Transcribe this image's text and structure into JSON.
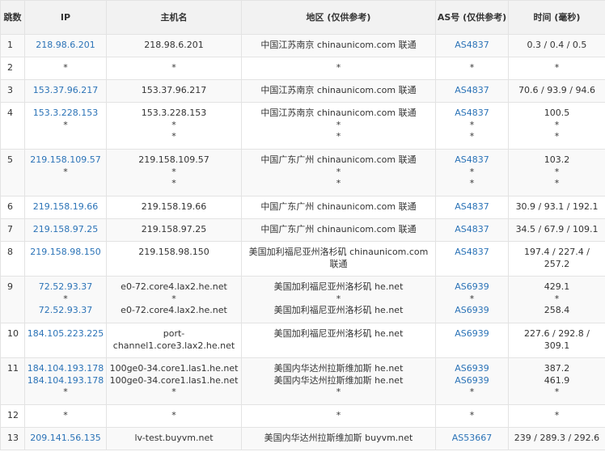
{
  "headers": [
    "跳数",
    "IP",
    "主机名",
    "地区 (仅供参考)",
    "AS号 (仅供参考)",
    "时间 (毫秒)"
  ],
  "rows": [
    {
      "hop": "1",
      "ip": [
        "218.98.6.201"
      ],
      "host": [
        "218.98.6.201"
      ],
      "region": [
        "中国江苏南京 chinaunicom.com 联通"
      ],
      "as": [
        "AS4837"
      ],
      "time": [
        "0.3 / 0.4 / 0.5"
      ]
    },
    {
      "hop": "2",
      "ip": [
        "*"
      ],
      "host": [
        "*"
      ],
      "region": [
        "*"
      ],
      "as": [
        "*"
      ],
      "time": [
        "*"
      ]
    },
    {
      "hop": "3",
      "ip": [
        "153.37.96.217"
      ],
      "host": [
        "153.37.96.217"
      ],
      "region": [
        "中国江苏南京 chinaunicom.com 联通"
      ],
      "as": [
        "AS4837"
      ],
      "time": [
        "70.6 / 93.9 / 94.6"
      ]
    },
    {
      "hop": "4",
      "ip": [
        "153.3.228.153",
        "*"
      ],
      "host": [
        "153.3.228.153",
        "*",
        "*"
      ],
      "region": [
        "中国江苏南京 chinaunicom.com 联通",
        "*",
        "*"
      ],
      "as": [
        "AS4837",
        "*",
        "*"
      ],
      "time": [
        "100.5",
        "*",
        "*"
      ]
    },
    {
      "hop": "5",
      "ip": [
        "219.158.109.57",
        "*"
      ],
      "host": [
        "219.158.109.57",
        "*",
        "*"
      ],
      "region": [
        "中国广东广州 chinaunicom.com 联通",
        "*",
        "*"
      ],
      "as": [
        "AS4837",
        "*",
        "*"
      ],
      "time": [
        "103.2",
        "*",
        "*"
      ]
    },
    {
      "hop": "6",
      "ip": [
        "219.158.19.66"
      ],
      "host": [
        "219.158.19.66"
      ],
      "region": [
        "中国广东广州 chinaunicom.com 联通"
      ],
      "as": [
        "AS4837"
      ],
      "time": [
        "30.9 / 93.1 / 192.1"
      ]
    },
    {
      "hop": "7",
      "ip": [
        "219.158.97.25"
      ],
      "host": [
        "219.158.97.25"
      ],
      "region": [
        "中国广东广州 chinaunicom.com 联通"
      ],
      "as": [
        "AS4837"
      ],
      "time": [
        "34.5 / 67.9 / 109.1"
      ]
    },
    {
      "hop": "8",
      "ip": [
        "219.158.98.150"
      ],
      "host": [
        "219.158.98.150"
      ],
      "region": [
        "美国加利福尼亚州洛杉矶 chinaunicom.com 联通"
      ],
      "as": [
        "AS4837"
      ],
      "time": [
        "197.4 / 227.4 / 257.2"
      ]
    },
    {
      "hop": "9",
      "ip": [
        "72.52.93.37",
        "*",
        "72.52.93.37"
      ],
      "host": [
        "e0-72.core4.lax2.he.net",
        "*",
        "e0-72.core4.lax2.he.net"
      ],
      "region": [
        "美国加利福尼亚州洛杉矶 he.net",
        "*",
        "美国加利福尼亚州洛杉矶 he.net"
      ],
      "as": [
        "AS6939",
        "*",
        "AS6939"
      ],
      "time": [
        "429.1",
        "*",
        "258.4"
      ]
    },
    {
      "hop": "10",
      "ip": [
        "184.105.223.225"
      ],
      "host": [
        "port-channel1.core3.lax2.he.net"
      ],
      "region": [
        "美国加利福尼亚州洛杉矶 he.net"
      ],
      "as": [
        "AS6939"
      ],
      "time": [
        "227.6 / 292.8 / 309.1"
      ]
    },
    {
      "hop": "11",
      "ip": [
        "184.104.193.178",
        "184.104.193.178",
        "*"
      ],
      "host": [
        "100ge0-34.core1.las1.he.net",
        "100ge0-34.core1.las1.he.net",
        "*"
      ],
      "region": [
        "美国内华达州拉斯维加斯 he.net",
        "美国内华达州拉斯维加斯 he.net",
        "*"
      ],
      "as": [
        "AS6939",
        "AS6939",
        "*"
      ],
      "time": [
        "387.2",
        "461.9",
        "*"
      ]
    },
    {
      "hop": "12",
      "ip": [
        "*"
      ],
      "host": [
        "*"
      ],
      "region": [
        "*"
      ],
      "as": [
        "*"
      ],
      "time": [
        "*"
      ]
    },
    {
      "hop": "13",
      "ip": [
        "209.141.56.135"
      ],
      "host": [
        "lv-test.buyvm.net"
      ],
      "region": [
        "美国内华达州拉斯维加斯 buyvm.net"
      ],
      "as": [
        "AS53667"
      ],
      "time": [
        "239 / 289.3 / 292.6"
      ]
    }
  ],
  "colors": {
    "link": "#2b73b7",
    "header_bg": "#f2f2f2",
    "row_alt_bg": "#f9f9f9",
    "border": "#e3e3e3"
  }
}
